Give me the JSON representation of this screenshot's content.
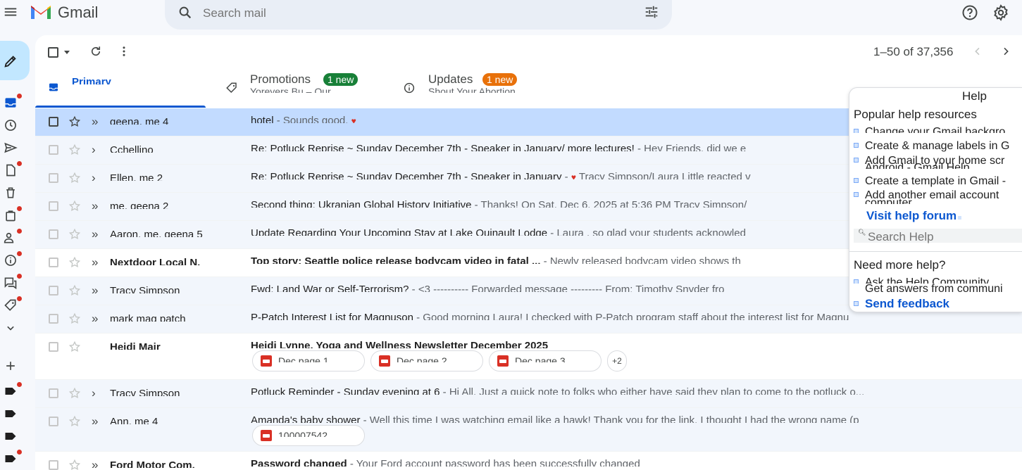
{
  "app": {
    "name": "Gmail"
  },
  "search": {
    "placeholder": "Search mail"
  },
  "toolbar": {
    "count": "1–50 of 37,356"
  },
  "tabs": [
    {
      "name": "Primary",
      "snippet": "",
      "badge": ""
    },
    {
      "name": "Promotions",
      "snippet": "Yoreyers Bu – Our",
      "badge": "1 new",
      "badge_color": "#188038"
    },
    {
      "name": "Updates",
      "snippet": "Shout Your Abortion",
      "badge": "1 new",
      "badge_color": "#e8710a"
    }
  ],
  "emails": [
    {
      "sender": "geena, me 4",
      "subject": "hotel",
      "snippet": " - Sounds good. ",
      "heart": "♥",
      "unread": false,
      "selected": true,
      "important": "»"
    },
    {
      "sender": "Cchellino",
      "subject": "Re: Potluck Reprise ~ Sunday December 7th - Speaker in January/ more lectures!",
      "snippet": " - Hey Friends, did we e",
      "heart": "",
      "unread": false,
      "selected": false,
      "important": "›"
    },
    {
      "sender": "Ellen, me 2",
      "subject": "Re: Potluck Reprise ~ Sunday December 7th - Speaker in January",
      "snippet": " - ",
      "heart": "♥",
      "snippet2": " Tracy Simpson/Laura Little reacted v",
      "unread": false,
      "selected": false,
      "important": "›"
    },
    {
      "sender": "me, geena 2",
      "subject": "Second thing: Ukranian Global History Initiative",
      "snippet": " - Thanks! On Sat, Dec 6, 2025 at 5:36 PM Tracy Simpson/",
      "heart": "",
      "unread": false,
      "selected": false,
      "important": "»"
    },
    {
      "sender": "Aaron, me, geena 5",
      "subject": "Update Regarding Your Upcoming Stay at Lake Quinault Lodge",
      "snippet": " - Laura , so glad your students acknowled",
      "heart": "",
      "unread": false,
      "selected": false,
      "important": "»"
    },
    {
      "sender": "Nextdoor Local N.",
      "subject": "Top story: Seattle police release bodycam video in fatal ...",
      "snippet": " - Newly released bodycam video shows th",
      "heart": "",
      "unread": true,
      "selected": false,
      "important": "»"
    },
    {
      "sender": "Tracy Simpson",
      "subject": "Fwd: Land War or Self-Terrorism?",
      "snippet": " - <3 ---------- Forwarded message --------- From: Timothy Snyder fro",
      "heart": "",
      "unread": false,
      "selected": false,
      "important": "»"
    },
    {
      "sender": "mark mag patch",
      "subject": "P-Patch Interest List for Magnuson",
      "snippet": " - Good morning Laura! I checked with P-Patch program staff about the interest list for Magnu",
      "heart": "",
      "unread": false,
      "selected": false,
      "important": "»"
    },
    {
      "sender": "Heidi Mair",
      "subject": "Heidi Lynne, Yoga and Wellness Newsletter December 2025",
      "snippet": "",
      "heart": "",
      "unread": true,
      "selected": false,
      "important": "",
      "attachments": [
        "Dec page 1",
        "Dec page 2",
        "Dec page 3"
      ],
      "more": "+2"
    },
    {
      "sender": "Tracy Simpson",
      "subject": "Potluck Reminder - Sunday evening at 6",
      "snippet": " - Hi All, Just a quick note to folks who either have said they plan to come to the potluck o...",
      "heart": "",
      "unread": false,
      "selected": false,
      "important": "›"
    },
    {
      "sender": "Ann, me 4",
      "subject": "Amanda's baby shower",
      "snippet": " - Well this time I was watching email like a hawk! Thank you for the link. I thought I had the wrong name (p",
      "heart": "",
      "unread": false,
      "selected": false,
      "important": "»",
      "attachments": [
        "100007542"
      ]
    },
    {
      "sender": "Ford Motor Com.",
      "subject": "Password changed",
      "snippet": " - Your Ford account password has been successfully changed",
      "heart": "",
      "unread": true,
      "selected": false,
      "important": "»"
    }
  ],
  "help_panel": {
    "title": "Help",
    "popular_heading": "Popular help resources",
    "items": [
      "Change your Gmail backgro",
      "Create & manage labels in G",
      "Add Gmail to your home scr",
      "Android - Gmail Help",
      "Create a template in Gmail -",
      "Add another email account",
      "computer"
    ],
    "forum_link": "Visit help forum",
    "search_placeholder": "Search Help",
    "more_heading": "Need more help?",
    "community": "Ask the Help Community",
    "community_sub": "Get answers from communi",
    "feedback": "Send feedback"
  },
  "colors": {
    "accent": "#0b57d0",
    "compose": "#c2e7ff",
    "selected_row": "#c2dbff",
    "notify_dot": "#d93025"
  },
  "icons": {
    "rail": [
      "inbox-icon",
      "snoozed-icon",
      "sent-icon",
      "drafts-icon",
      "trash-icon",
      "purchases-icon",
      "social-icon",
      "updates-icon",
      "forums-icon",
      "promotions-icon",
      "more-icon"
    ],
    "labels": [
      "label-icon",
      "label-icon",
      "label-icon",
      "label-icon"
    ]
  }
}
